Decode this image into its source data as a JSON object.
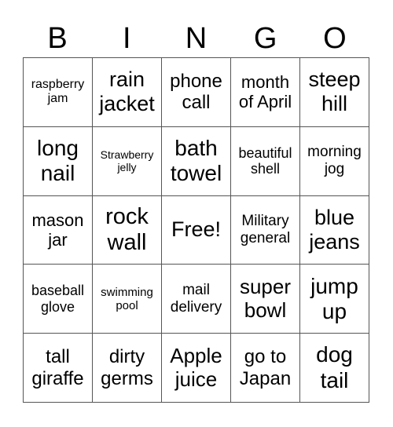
{
  "header": [
    "B",
    "I",
    "N",
    "G",
    "O"
  ],
  "board": [
    [
      "raspberry jam",
      "rain jacket",
      "phone call",
      "month of April",
      "steep hill"
    ],
    [
      "long nail",
      "Strawberry jelly",
      "bath towel",
      "beautiful shell",
      "morning jog"
    ],
    [
      "mason jar",
      "rock wall",
      "Free!",
      "Military general",
      "blue jeans"
    ],
    [
      "baseball glove",
      "swimming pool",
      "mail delivery",
      "super bowl",
      "jump up"
    ],
    [
      "tall giraffe",
      "dirty germs",
      "Apple juice",
      "go to Japan",
      "dog tail"
    ]
  ]
}
